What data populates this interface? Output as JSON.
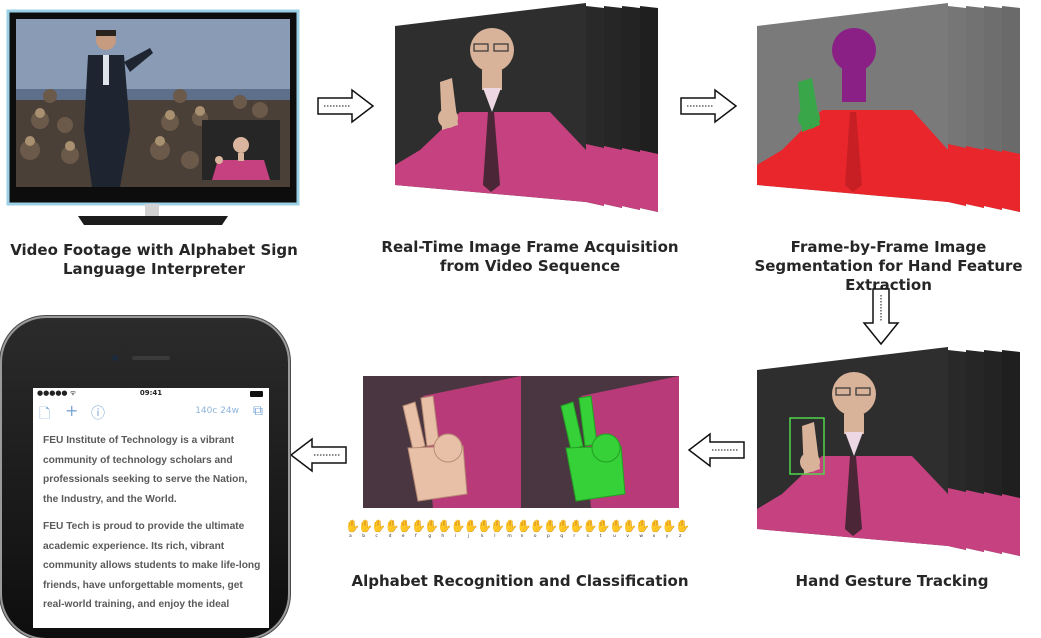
{
  "stages": {
    "tv": {
      "caption": "Video Footage with Alphabet Sign Language Interpreter"
    },
    "acquisition": {
      "caption": "Real-Time Image Frame Acquisition from Video Sequence"
    },
    "segmentation": {
      "caption": "Frame-by-Frame Image Segmentation for Hand Feature Extraction"
    },
    "tracking": {
      "caption": "Hand Gesture Tracking"
    },
    "recognition": {
      "caption": "Alphabet Recognition and Classification"
    }
  },
  "alphabet": [
    "a",
    "b",
    "c",
    "d",
    "e",
    "f",
    "g",
    "h",
    "i",
    "j",
    "k",
    "l",
    "m",
    "n",
    "o",
    "p",
    "q",
    "r",
    "s",
    "t",
    "u",
    "v",
    "w",
    "x",
    "y",
    "z"
  ],
  "phone": {
    "status_dots": "●●●●● ᯤ",
    "time": "09:41",
    "count": "140c 24w",
    "icon_file": "🗋",
    "icon_plus": "+",
    "icon_info": "ⓘ",
    "icon_share": "⧉",
    "paragraph1": "FEU Institute of Technology is a vibrant community of technology scholars and professionals seeking to serve the Nation, the Industry, and the World.",
    "paragraph2": "FEU Tech is proud to provide the ultimate academic experience. Its rich, vibrant community allows students to make life-long friends, have unforgettable moments, get real-world training, and enjoy the ideal"
  },
  "colors": {
    "shirt": "#c5417f",
    "segment_body": "#e8262b",
    "segment_head": "#8a1f86",
    "segment_hand": "#3aa64a",
    "hand_green": "#36d038",
    "tracking_box": "#4fd64a"
  }
}
